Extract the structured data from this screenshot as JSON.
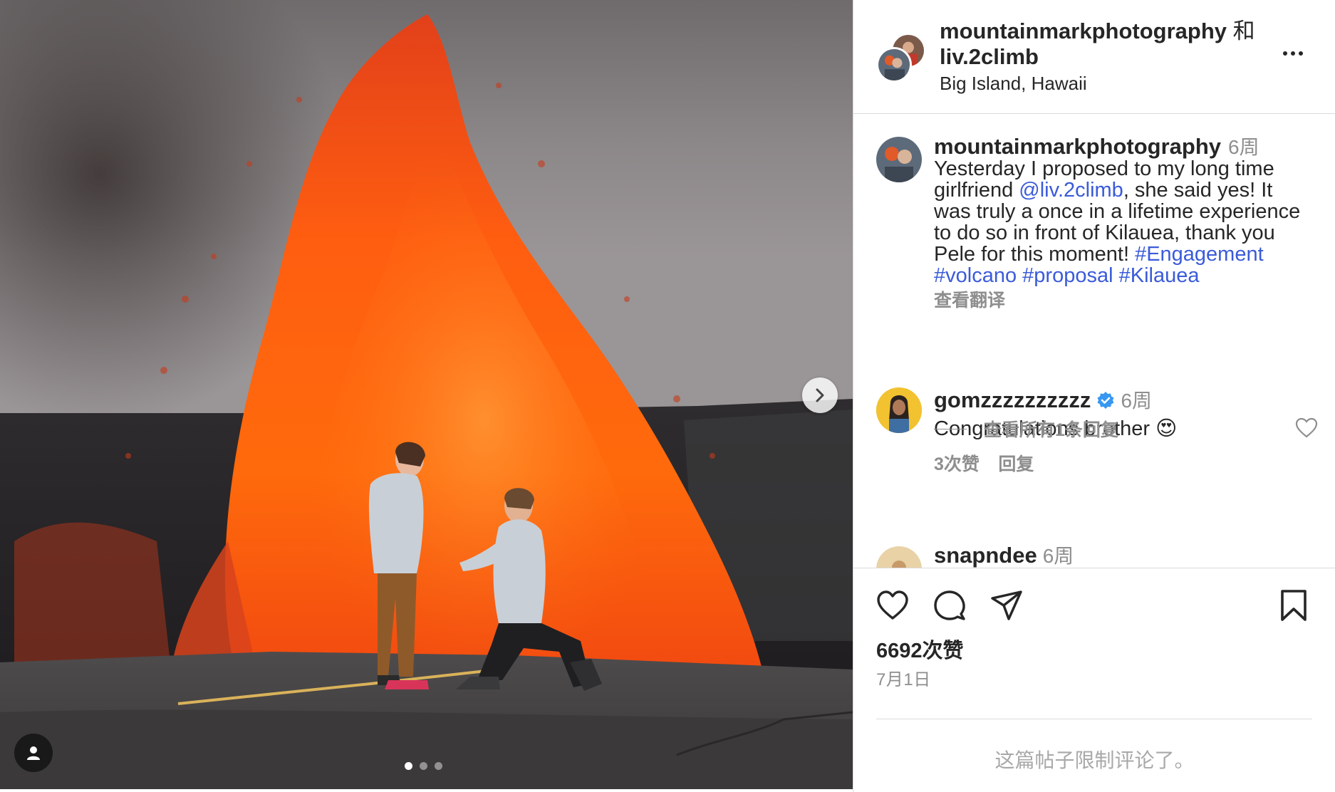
{
  "media": {
    "image": "volcano-proposal-photo",
    "next_icon": "chevron-right-icon",
    "tag_icon": "user-tag-icon",
    "carousel": {
      "count": 3,
      "active_index": 0
    }
  },
  "header": {
    "author": "mountainmarkphotography",
    "joiner": "和",
    "coauthor": "liv.2climb",
    "location": "Big Island, Hawaii",
    "more_icon": "more-options-icon"
  },
  "caption": {
    "username": "mountainmarkphotography",
    "time": "6周",
    "text_1": "Yesterday I proposed to my long time girlfriend ",
    "mention": "@liv.2climb",
    "text_2": ", she said yes!  It was truly a once in a lifetime experience to do so in front of Kilauea, thank you Pele for this moment! ",
    "hashtags": [
      "#Engagement",
      "#volcano",
      "#proposal",
      "#Kilauea"
    ],
    "translate": "查看翻译"
  },
  "comments": [
    {
      "username": "gomzzzzzzzzzz",
      "verified": true,
      "time": "6周",
      "text": "Congratulations brother",
      "emoji": "😍",
      "likes": "3次赞",
      "reply": "回复",
      "view_replies": "查看所有1条回复"
    },
    {
      "username": "snapndee",
      "time": "6周"
    }
  ],
  "actions": {
    "like_icon": "heart-icon",
    "comment_icon": "comment-icon",
    "share_icon": "send-icon",
    "save_icon": "bookmark-icon",
    "likes": "6692次赞",
    "date": "7月1日",
    "comments_limited": "这篇帖子限制评论了。"
  },
  "colors": {
    "link": "#3a5bd9",
    "verified": "#3897f0",
    "muted": "#8e8e8e",
    "lava": "#ff5a12"
  }
}
